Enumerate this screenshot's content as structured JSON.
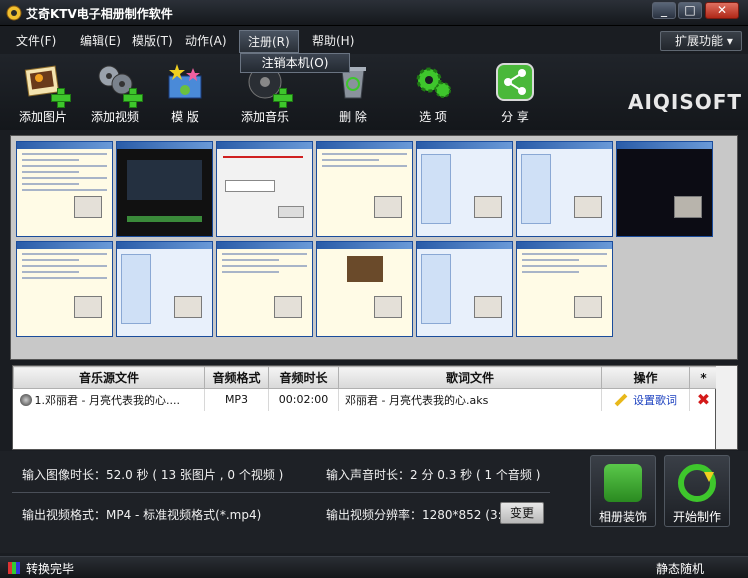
{
  "window": {
    "title": "艾奇KTV电子相册制作软件",
    "controls": [
      "_",
      "□",
      "✕"
    ]
  },
  "menu": {
    "items": [
      "文件(F)",
      "编辑(E)",
      "模版(T)",
      "动作(A)",
      "注册(R)",
      "帮助(H)"
    ],
    "dropdown_item": "注销本机(O)",
    "extension_button": "扩展功能 ▾"
  },
  "toolbar": {
    "add_image": "添加图片",
    "add_video": "添加视频",
    "template": "模 版",
    "add_music": "添加音乐",
    "delete": "删 除",
    "options": "选 项",
    "share": "分 享",
    "brand": "AIQISOFT"
  },
  "thumbnails": {
    "count": 13
  },
  "music_table": {
    "columns": [
      "音乐源文件",
      "音频格式",
      "音频时长",
      "歌词文件",
      "操作",
      "*"
    ],
    "rows": [
      {
        "source": "1.邓丽君 - 月亮代表我的心....",
        "format": "MP3",
        "duration": "00:02:00",
        "lyrics": "邓丽君 - 月亮代表我的心.aks",
        "action": "设置歌词",
        "delete": "✖"
      }
    ]
  },
  "info": {
    "image_duration": "输入图像时长：52.0 秒 ( 13 张图片 , 0 个视频 )",
    "audio_duration": "输入声音时长：2 分 0.3 秒 ( 1 个音频 )",
    "output_format": "输出视频格式：MP4 - 标准视频格式(*.mp4)",
    "output_resolution": "输出视频分辨率：1280*852 (3:2)",
    "change_button": "变更",
    "decorate_button": "相册装饰",
    "start_button": "开始制作"
  },
  "status": {
    "text": "转换完毕",
    "random_mode": "静态随机"
  },
  "colors": {
    "bg": "#1a1d22",
    "plus_green": "#3ec62c",
    "link_blue": "#1a3fbf",
    "delete_red": "#d41a1a"
  }
}
